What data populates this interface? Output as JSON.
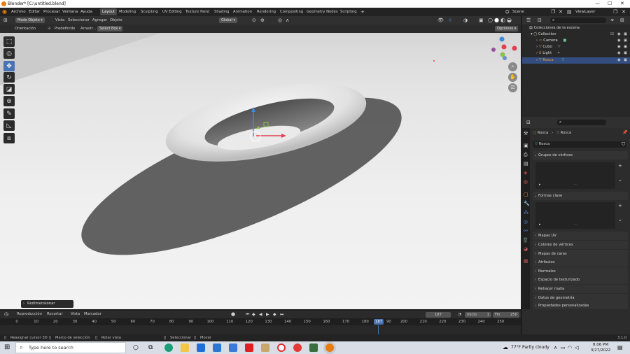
{
  "window": {
    "title": "Blender* [C:\\untitled.blend]"
  },
  "menu": {
    "items": [
      "Archivo",
      "Editar",
      "Procesar",
      "Ventana",
      "Ayuda"
    ]
  },
  "workspaces": {
    "tabs": [
      "Layout",
      "Modeling",
      "Sculpting",
      "UV Editing",
      "Texture Paint",
      "Shading",
      "Animation",
      "Rendering",
      "Compositing",
      "Geometry Nodes",
      "Scripting"
    ],
    "active": "Layout",
    "add": "+"
  },
  "scene": {
    "label": "Scene",
    "view_layer": "ViewLayer"
  },
  "viewport_header": {
    "mode": "Modo Objeto",
    "items": [
      "Vista",
      "Seleccionar",
      "Agregar",
      "Objeto"
    ],
    "transform": "Global"
  },
  "viewport_subheader": {
    "orientation": "Orientación",
    "default": "Predefinido",
    "drag": "Arrastr...",
    "select": "Select Box",
    "options": "Opciones"
  },
  "last_operator": "Redimensionar",
  "outliner": {
    "root": "Colecciones de la escena",
    "collection": "Collection",
    "items": [
      "Camera",
      "Cubo",
      "Light",
      "Rosca"
    ],
    "selected": "Rosca"
  },
  "properties": {
    "breadcrumb_object": "Rosca",
    "breadcrumb_data": "Rosca",
    "mesh_name": "Rosca",
    "panels_open": [
      "Grupos de vértices",
      "Formas clave"
    ],
    "panels_closed": [
      "Mapas UV",
      "Colores de vértices",
      "Mapas de caras",
      "Atributos",
      "Normales",
      "Espacio de texturizado",
      "Rehacer malla",
      "Datos de geometría",
      "Propiedades personalizadas"
    ]
  },
  "timeline": {
    "menus": [
      "Reproducción",
      "Recortar",
      "Vista",
      "Marcador"
    ],
    "current_frame": "187",
    "start_label": "Inicio",
    "start": "1",
    "end_label": "Fin",
    "end": "250",
    "ticks": [
      "0",
      "10",
      "20",
      "30",
      "40",
      "50",
      "60",
      "70",
      "80",
      "90",
      "100",
      "110",
      "120",
      "130",
      "140",
      "150",
      "160",
      "170",
      "180",
      "190",
      "200",
      "210",
      "220",
      "230",
      "240",
      "250"
    ],
    "current_display": "187"
  },
  "statusbar": {
    "items": [
      "Reasignar cursor 3D",
      "Marco de selección",
      "Rotar vista",
      "Seleccionar",
      "Mover"
    ],
    "version": "3.1.0"
  },
  "taskbar": {
    "search_placeholder": "Type here to search",
    "weather": "77°F  Partly cloudy",
    "time": "8:06 PM",
    "date": "3/27/2022"
  },
  "colors": {
    "accent": "#4772b3",
    "selection": "#334d80",
    "x_axis": "#e0404f",
    "y_axis": "#8bc34a",
    "z_axis": "#3d8be0"
  }
}
